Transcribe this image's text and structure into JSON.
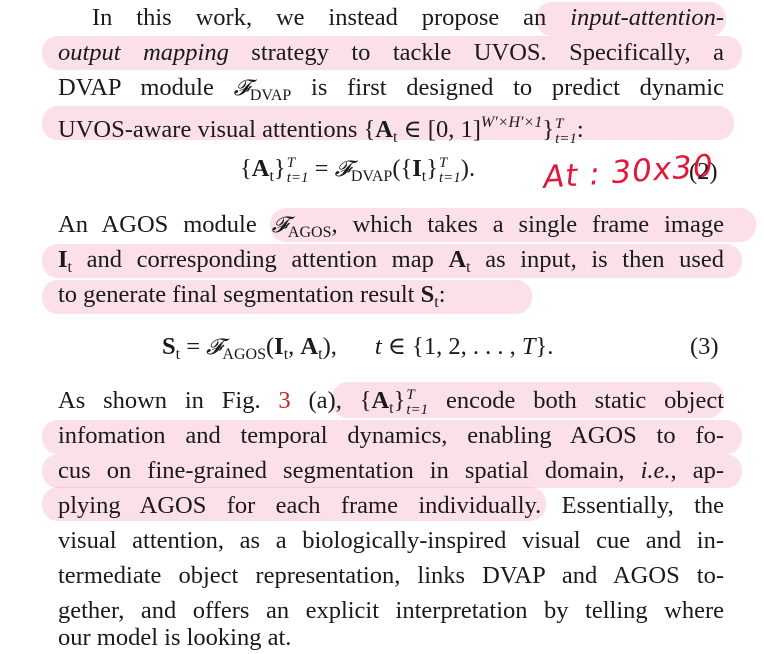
{
  "paragraph1": {
    "l1a": "In this work, we instead propose an ",
    "l1b": "input-attention-",
    "l2a": "output mapping",
    "l2b": " strategy to tackle UVOS. Specifically, a",
    "l3a": "DVAP module ",
    "l3b": " is first designed to predict dynamic",
    "l4a": "UVOS-aware visual attentions {",
    "l4b": "∈ [0, 1]",
    "l4c": "}",
    "l4d": ":"
  },
  "symbols": {
    "F": "𝓕",
    "DVAP": "DVAP",
    "AGOS": "AGOS",
    "A": "A",
    "I": "I",
    "S": "S",
    "t": "t",
    "T": "T",
    "t1": "t=1",
    "whsup": "W′×H′×1"
  },
  "eq2": {
    "p1": "{",
    "p2": "}",
    "eq": " = ",
    "p3": "({",
    "p4": "}",
    "p5": ").",
    "number": "(2)"
  },
  "annotation": {
    "handwritten": "At : 30x30"
  },
  "paragraph2": {
    "l1a": "An AGOS module ",
    "l1b": ", which takes a single frame image",
    "l2a": " and corresponding attention map ",
    "l2b": " as input, is then used",
    "l3a": "to generate final segmentation result ",
    "l3b": ":"
  },
  "eq3": {
    "eq": " = ",
    "args": "(",
    "comma": ", ",
    "close": "),",
    "domain_a": "t",
    "domain_b": " ∈ {1, 2, . . . , ",
    "domain_c": "}.",
    "number": "(3)"
  },
  "paragraph3": {
    "l1a": "As shown in Fig. ",
    "l1ref": "3",
    "l1b": " (a), {",
    "l1c": "}",
    "l1d": " encode both static object",
    "l2": "infomation and temporal dynamics, enabling AGOS to fo-",
    "l3a": "cus on fine-grained segmentation in spatial domain, ",
    "l3b": "i.e.",
    "l3c": ", ap-",
    "l4": "plying AGOS for each frame individually.  Essentially, the",
    "l5": "visual attention, as a biologically-inspired visual cue and in-",
    "l6": "termediate object representation, links DVAP and AGOS to-",
    "l7": "gether, and offers an explicit interpretation by telling where",
    "l8": "our model is looking at."
  }
}
